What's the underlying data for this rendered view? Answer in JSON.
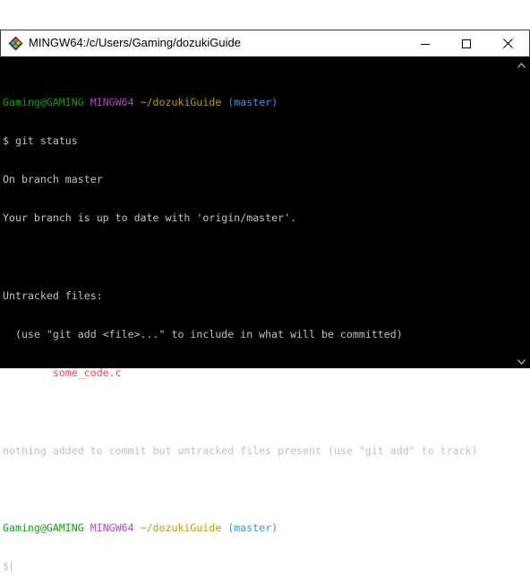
{
  "window": {
    "title": "MINGW64:/c/Users/Gaming/dozukiGuide"
  },
  "terminal": {
    "prompt1": {
      "user_host": "Gaming@GAMING",
      "env": "MINGW64",
      "path": "~/dozukiGuide",
      "branch": "(master)"
    },
    "command": "$ git status",
    "output": [
      "On branch master",
      "Your branch is up to date with 'origin/master'.",
      "",
      "Untracked files:",
      "  (use \"git add <file>...\" to include in what will be committed)"
    ],
    "untracked_file": "some_code.c",
    "summary": "nothing added to commit but untracked files present (use \"git add\" to track)",
    "prompt2": {
      "user_host": "Gaming@GAMING",
      "env": "MINGW64",
      "path": "~/dozukiGuide",
      "branch": "(master)"
    },
    "input_prompt": "$"
  },
  "icons": {
    "app": "git-bash-icon",
    "minimize": "minimize-icon",
    "maximize": "maximize-icon",
    "close": "close-icon",
    "scroll_up": "chevron-up-icon",
    "scroll_down": "chevron-down-icon"
  },
  "colors": {
    "user_host": "#13a10e",
    "env": "#b148c6",
    "path": "#c19c00",
    "branch": "#3a96dd",
    "untracked": "#e74856",
    "text": "#c0c0c0",
    "background": "#000000"
  }
}
